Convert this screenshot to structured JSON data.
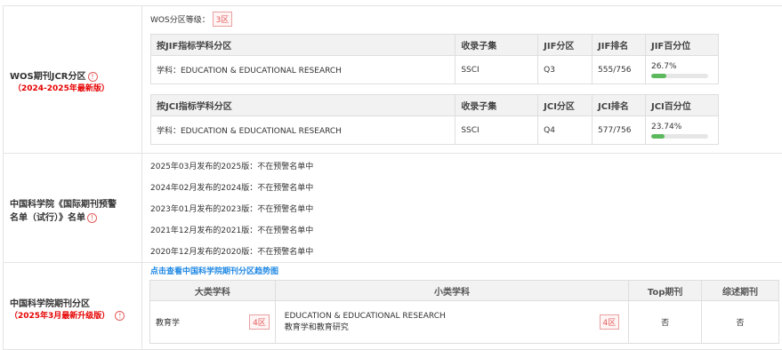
{
  "wos": {
    "label": "WOS期刊JCR分区",
    "sub": "（2024-2025年最新版）",
    "grade_label": "WOS分区等级：",
    "grade_value": "3区",
    "jif_table": {
      "headers": [
        "按JIF指标学科分区",
        "收录子集",
        "JIF分区",
        "JIF排名",
        "JIF百分位"
      ],
      "row": {
        "subject": "学科：EDUCATION & EDUCATIONAL RESEARCH",
        "set": "SSCI",
        "zone": "Q3",
        "rank": "555/756",
        "pct": "26.7%",
        "pct_value": 26.7
      }
    },
    "jci_table": {
      "headers": [
        "按JCI指标学科分区",
        "收录子集",
        "JCI分区",
        "JCI排名",
        "JCI百分位"
      ],
      "row": {
        "subject": "学科：EDUCATION & EDUCATIONAL RESEARCH",
        "set": "SSCI",
        "zone": "Q4",
        "rank": "577/756",
        "pct": "23.74%",
        "pct_value": 23.74
      }
    }
  },
  "warning": {
    "label_1": "中国科学院《国际期刊预警",
    "label_2": "名单（试行）》名单",
    "lines": [
      "2025年03月发布的2025版：不在预警名单中",
      "2024年02月发布的2024版：不在预警名单中",
      "2023年01月发布的2023版：不在预警名单中",
      "2021年12月发布的2021版：不在预警名单中",
      "2020年12月发布的2020版：不在预警名单中"
    ]
  },
  "cas": {
    "label": "中国科学院期刊分区",
    "sub": "（2025年3月最新升级版）",
    "link": "点击查看中国科学院期刊分区趋势图",
    "headers": [
      "大类学科",
      "小类学科",
      "Top期刊",
      "综述期刊"
    ],
    "row": {
      "major": "教育学",
      "major_zone": "4区",
      "minor_en": "EDUCATION & EDUCATIONAL RESEARCH",
      "minor_cn": "教育学和教育研究",
      "minor_zone": "4区",
      "top": "否",
      "review": "否"
    }
  },
  "colors": {
    "accent_red": "#e60000",
    "link_blue": "#1e88e5",
    "bar_green": "#5cb85c"
  },
  "icons": [
    "info-icon"
  ]
}
